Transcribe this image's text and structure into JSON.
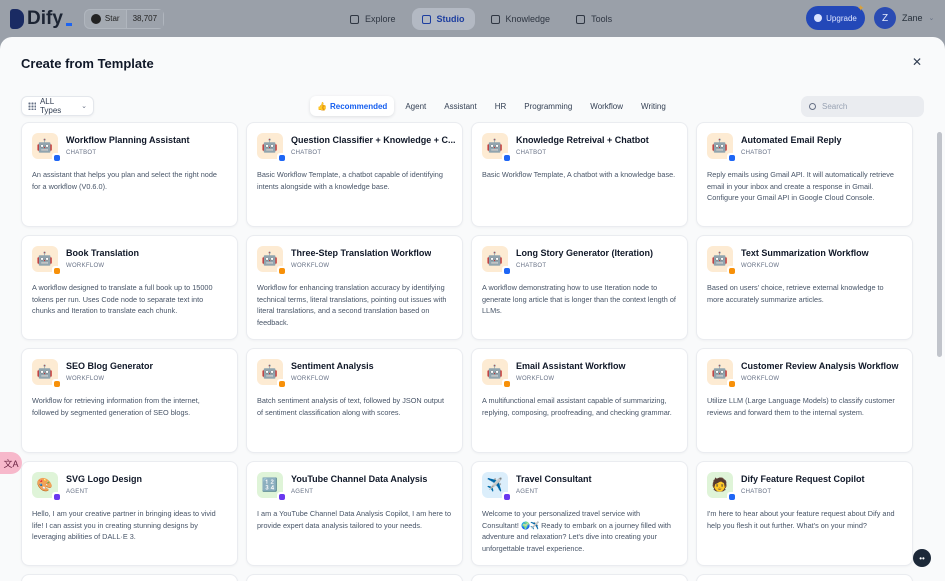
{
  "app": {
    "brand": "Dify",
    "github_label": "Star",
    "github_count": "38,707"
  },
  "nav": [
    {
      "label": "Explore",
      "icon": "compass-icon",
      "active": false
    },
    {
      "label": "Studio",
      "icon": "robot-icon",
      "active": true
    },
    {
      "label": "Knowledge",
      "icon": "book-icon",
      "active": false
    },
    {
      "label": "Tools",
      "icon": "wrench-icon",
      "active": false
    }
  ],
  "upgrade_label": "Upgrade",
  "user": {
    "initial": "Z",
    "name": "Zane"
  },
  "modal": {
    "title": "Create from Template",
    "type_filter": "ALL Types",
    "categories": [
      "Recommended",
      "Agent",
      "Assistant",
      "HR",
      "Programming",
      "Workflow",
      "Writing"
    ],
    "active_category": "Recommended",
    "search_placeholder": "Search"
  },
  "templates": [
    {
      "title": "Workflow Planning Assistant",
      "type": "CHATBOT",
      "icon": "robot-icon",
      "bg": "orange",
      "desc": "An assistant that helps you plan and select the right node for a workflow (V0.6.0)."
    },
    {
      "title": "Question Classifier + Knowledge + C...",
      "type": "CHATBOT",
      "icon": "robot-icon",
      "bg": "orange",
      "desc": "Basic Workflow Template, a chatbot capable of identifying intents alongside with a knowledge base."
    },
    {
      "title": "Knowledge Retreival + Chatbot",
      "type": "CHATBOT",
      "icon": "robot-icon",
      "bg": "orange",
      "desc": "Basic Workflow Template, A chatbot with a knowledge base."
    },
    {
      "title": "Automated Email Reply",
      "type": "CHATBOT",
      "icon": "robot-icon",
      "bg": "orange",
      "desc": "Reply emails using Gmail API. It will automatically retrieve email in your inbox and create a response in Gmail. Configure your Gmail API in Google Cloud Console."
    },
    {
      "title": "Book Translation",
      "type": "WORKFLOW",
      "icon": "robot-icon",
      "bg": "orange",
      "desc": "A workflow designed to translate a full book up to 15000 tokens per run. Uses Code node to separate text into chunks and Iteration to translate each chunk."
    },
    {
      "title": "Three-Step Translation Workflow",
      "type": "WORKFLOW",
      "icon": "robot-icon",
      "bg": "orange",
      "desc": "Workflow for enhancing translation accuracy by identifying technical terms, literal translations, pointing out issues with literal translations, and a second translation based on feedback."
    },
    {
      "title": "Long Story Generator (Iteration)",
      "type": "CHATBOT",
      "icon": "robot-icon",
      "bg": "orange",
      "desc": "A workflow demonstrating how to use Iteration node to generate long article that is longer than the context length of LLMs."
    },
    {
      "title": "Text Summarization Workflow",
      "type": "WORKFLOW",
      "icon": "robot-icon",
      "bg": "orange",
      "desc": "Based on users' choice, retrieve external knowledge to more accurately summarize articles."
    },
    {
      "title": "SEO Blog Generator",
      "type": "WORKFLOW",
      "icon": "robot-icon",
      "bg": "orange",
      "desc": "Workflow for retrieving information from the internet, followed by segmented generation of SEO blogs."
    },
    {
      "title": "Sentiment Analysis",
      "type": "WORKFLOW",
      "icon": "robot-icon",
      "bg": "orange",
      "desc": "Batch sentiment analysis of text, followed by JSON output of sentiment classification along with scores."
    },
    {
      "title": "Email Assistant Workflow",
      "type": "WORKFLOW",
      "icon": "robot-icon",
      "bg": "orange",
      "desc": "A multifunctional email assistant capable of summarizing, replying, composing, proofreading, and checking grammar."
    },
    {
      "title": "Customer Review Analysis Workflow",
      "type": "WORKFLOW",
      "icon": "robot-icon",
      "bg": "orange",
      "desc": "Utilize LLM (Large Language Models) to classify customer reviews and forward them to the internal system."
    },
    {
      "title": "SVG Logo Design",
      "type": "AGENT",
      "icon": "palette-icon",
      "bg": "green",
      "desc": "Hello, I am your creative partner in bringing ideas to vivid life! I can assist you in creating stunning designs by leveraging abilities of DALL·E 3."
    },
    {
      "title": "YouTube Channel Data Analysis",
      "type": "AGENT",
      "icon": "numbers-icon",
      "bg": "green",
      "desc": "I am a YouTube Channel Data Analysis Copilot, I am here to provide expert data analysis tailored to your needs."
    },
    {
      "title": "Travel Consultant",
      "type": "AGENT",
      "icon": "airplane-icon",
      "bg": "blue",
      "desc": "Welcome to your personalized travel service with Consultant! 🌍✈️ Ready to embark on a journey filled with adventure and relaxation? Let's dive into creating your unforgettable travel experience."
    },
    {
      "title": "Dify Feature Request Copilot",
      "type": "CHATBOT",
      "icon": "person-icon",
      "bg": "green",
      "desc": "I'm here to hear about your feature request about Dify and help you flesh it out further. What's on your mind?"
    }
  ]
}
